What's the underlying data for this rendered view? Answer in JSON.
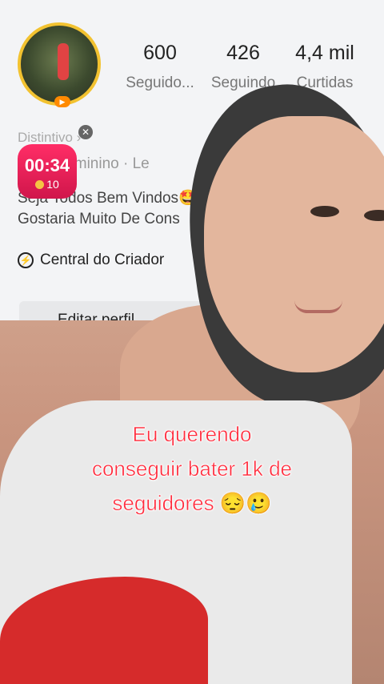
{
  "profile": {
    "stats": [
      {
        "value": "600",
        "label": "Seguido..."
      },
      {
        "value": "426",
        "label": "Seguindo"
      },
      {
        "value": "4,4 mil",
        "label": "Curtidas"
      }
    ],
    "badge_text": "Distintivo ›",
    "meta": "065 · Feminino · Le",
    "bio_line1": "Seja Todos Bem Vindos🤩",
    "bio_line2": "Gostaria Muito De Cons",
    "creator_center": "Central do Criador",
    "edit_profile": "Editar perfil"
  },
  "timer": {
    "time": "00:34",
    "coins": "10"
  },
  "caption": {
    "line1": "Eu querendo",
    "line2": "conseguir bater 1k de",
    "line3": "seguidores 😔🥲"
  },
  "colors": {
    "timer_bg": "#e11a54",
    "caption_text": "#ff2b3c",
    "avatar_ring": "#f2c230"
  }
}
